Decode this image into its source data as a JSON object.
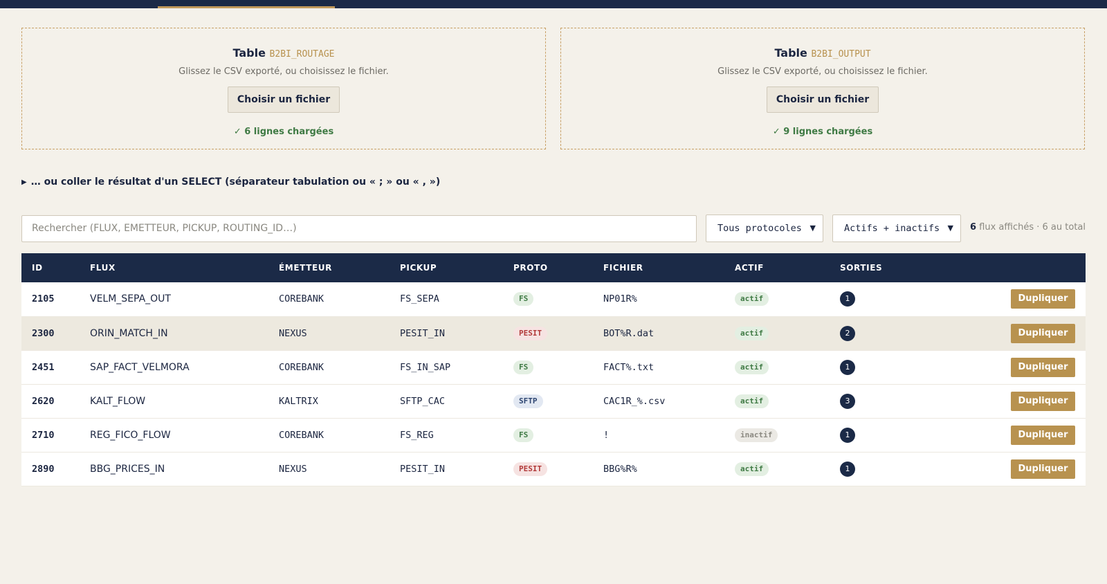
{
  "colors": {
    "navy": "#1b2a47",
    "gold": "#b8924f",
    "background": "#f4f1ea",
    "green": "#3f7a44",
    "red": "#b23a3a"
  },
  "dropzones": [
    {
      "title": "Table",
      "table_name": "B2BI_ROUTAGE",
      "hint": "Glissez le CSV exporté, ou choisissez le fichier.",
      "button_label": "Choisir un fichier",
      "status": "✓ 6 lignes chargées"
    },
    {
      "title": "Table",
      "table_name": "B2BI_OUTPUT",
      "hint": "Glissez le CSV exporté, ou choisissez le fichier.",
      "button_label": "Choisir un fichier",
      "status": "✓ 9 lignes chargées"
    }
  ],
  "paste_toggle": {
    "icon": "triangle-right-icon",
    "label": "… ou coller le résultat d'un SELECT (séparateur tabulation ou « ; » ou « , »)"
  },
  "filters": {
    "search_placeholder": "Rechercher (FLUX, EMETTEUR, PICKUP, ROUTING_ID…)",
    "protocol_select": "Tous protocoles",
    "status_select": "Actifs + inactifs",
    "count_shown": "6",
    "count_text": " flux affichés · 6 au total"
  },
  "table": {
    "headers": [
      "ID",
      "FLUX",
      "ÉMETTEUR",
      "PICKUP",
      "PROTO",
      "FICHIER",
      "ACTIF",
      "SORTIES"
    ],
    "action_label": "Dupliquer",
    "rows": [
      {
        "id": "2105",
        "flux": "VELM_SEPA_OUT",
        "emetteur": "COREBANK",
        "pickup": "FS_SEPA",
        "proto": "FS",
        "fichier": "NP01R%",
        "actif": "actif",
        "sorties": "1"
      },
      {
        "id": "2300",
        "flux": "ORIN_MATCH_IN",
        "emetteur": "NEXUS",
        "pickup": "PESIT_IN",
        "proto": "PESIT",
        "fichier": "BOT%R.dat",
        "actif": "actif",
        "sorties": "2"
      },
      {
        "id": "2451",
        "flux": "SAP_FACT_VELMORA",
        "emetteur": "COREBANK",
        "pickup": "FS_IN_SAP",
        "proto": "FS",
        "fichier": "FACT%.txt",
        "actif": "actif",
        "sorties": "1"
      },
      {
        "id": "2620",
        "flux": "KALT_FLOW",
        "emetteur": "KALTRIX",
        "pickup": "SFTP_CAC",
        "proto": "SFTP",
        "fichier": "CAC1R_%.csv",
        "actif": "actif",
        "sorties": "3"
      },
      {
        "id": "2710",
        "flux": "REG_FICO_FLOW",
        "emetteur": "COREBANK",
        "pickup": "FS_REG",
        "proto": "FS",
        "fichier": "!",
        "actif": "inactif",
        "sorties": "1"
      },
      {
        "id": "2890",
        "flux": "BBG_PRICES_IN",
        "emetteur": "NEXUS",
        "pickup": "PESIT_IN",
        "proto": "PESIT",
        "fichier": "BBG%R%",
        "actif": "actif",
        "sorties": "1"
      }
    ]
  }
}
